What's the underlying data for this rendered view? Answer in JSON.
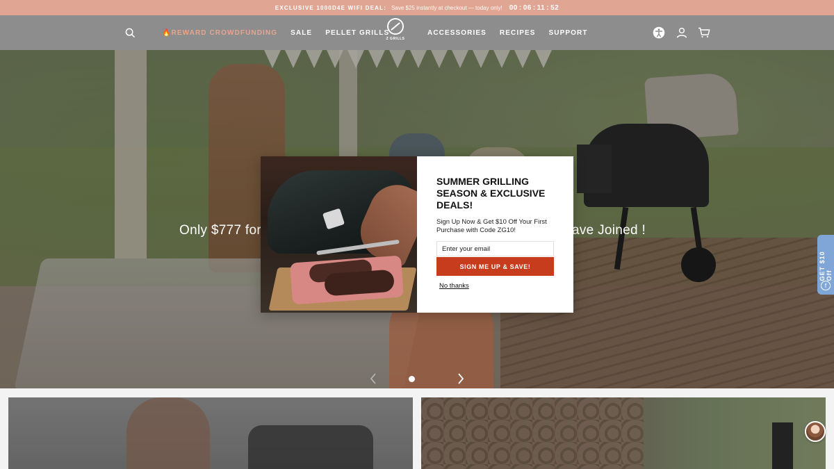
{
  "announcement": {
    "lead": "EXCLUSIVE 1000D4E WIFI DEAL:",
    "message": "Save $25 instantly at checkout — today only!",
    "timer": {
      "hours": "00",
      "minutes": "06",
      "seconds": "11",
      "fraction": "52"
    }
  },
  "nav": {
    "left": [
      "🔥REWARD CROWDFUNDING",
      "SALE",
      "PELLET GRILLS"
    ],
    "right": [
      "ACCESSORIES",
      "RECIPES",
      "SUPPORT"
    ],
    "logo_text": "Z GRILLS"
  },
  "hero": {
    "text_left": "Only $777 for",
    "text_right": "ave Joined !"
  },
  "side_tab": {
    "label": "GET $10 Off"
  },
  "modal": {
    "title": "SUMMER GRILLING SEASON & EXCLUSIVE DEALS!",
    "subtitle": "Sign Up Now & Get $10 Off Your First Purchase with Code ZG10!",
    "email_placeholder": "Enter your email",
    "cta": "SIGN ME UP & SAVE!",
    "dismiss": "No thanks"
  },
  "colors": {
    "announcement_bg": "#e0a693",
    "header_bg": "#8d8d8d",
    "reward_accent": "#e7a58e",
    "cta_bg": "#c83c1e",
    "side_tab_bg": "#7fa6d6"
  },
  "icons": [
    "search-icon",
    "accessibility-icon",
    "account-icon",
    "cart-icon",
    "chevron-left-icon",
    "chevron-right-icon",
    "facebook-icon"
  ]
}
